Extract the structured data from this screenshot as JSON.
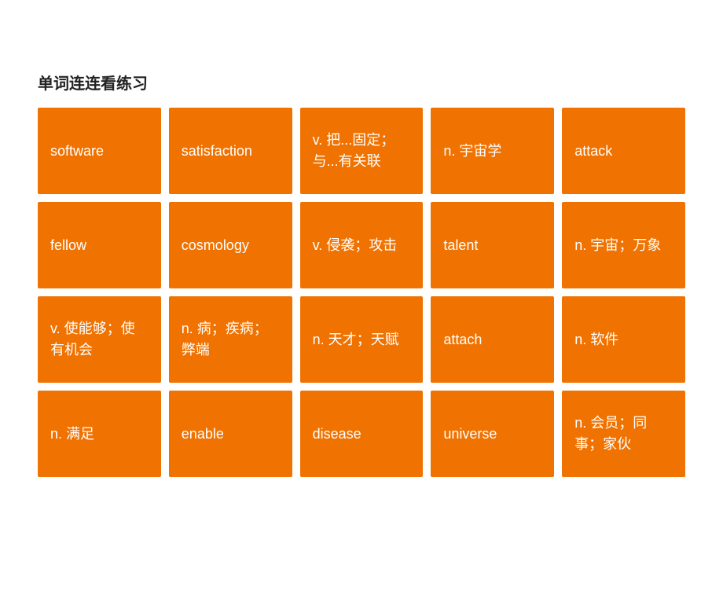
{
  "page": {
    "title": "单词连连看练习"
  },
  "cards": [
    {
      "id": 1,
      "text": "software"
    },
    {
      "id": 2,
      "text": "satisfaction"
    },
    {
      "id": 3,
      "text": "v. 把...固定；与...有关联"
    },
    {
      "id": 4,
      "text": "n. 宇宙学"
    },
    {
      "id": 5,
      "text": "attack"
    },
    {
      "id": 6,
      "text": "fellow"
    },
    {
      "id": 7,
      "text": "cosmology"
    },
    {
      "id": 8,
      "text": "v. 侵袭；攻击"
    },
    {
      "id": 9,
      "text": "talent"
    },
    {
      "id": 10,
      "text": "n. 宇宙；万象"
    },
    {
      "id": 11,
      "text": "v. 使能够；使有机会"
    },
    {
      "id": 12,
      "text": "n. 病；疾病；弊端"
    },
    {
      "id": 13,
      "text": "n. 天才；天赋"
    },
    {
      "id": 14,
      "text": "attach"
    },
    {
      "id": 15,
      "text": "n. 软件"
    },
    {
      "id": 16,
      "text": "n. 满足"
    },
    {
      "id": 17,
      "text": "enable"
    },
    {
      "id": 18,
      "text": "disease"
    },
    {
      "id": 19,
      "text": "universe"
    },
    {
      "id": 20,
      "text": "n. 会员；同事；家伙"
    }
  ]
}
